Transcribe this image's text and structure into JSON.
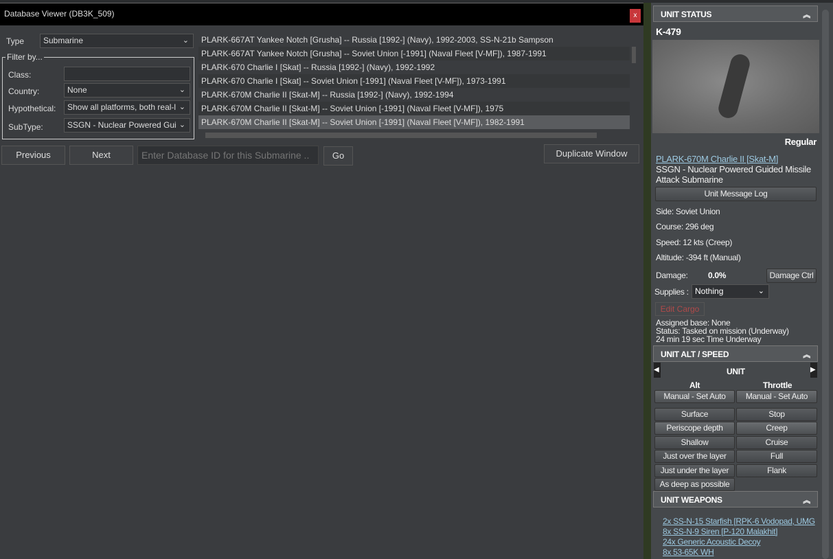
{
  "dialog": {
    "title": "Database Viewer (DB3K_509)",
    "close": "x",
    "type_label": "Type",
    "type_value": "Submarine",
    "filter_legend": "Filter by...",
    "class_label": "Class:",
    "class_value": "",
    "country_label": "Country:",
    "country_value": "None",
    "hypo_label": "Hypothetical:",
    "hypo_value": "Show all platforms, both real-l",
    "subtype_label": "SubType:",
    "subtype_value": "SSGN - Nuclear Powered Gui",
    "rows": [
      "PLARK-667AT Yankee Notch [Grusha] -- Russia [1992-] (Navy), 1992-2003, SS-N-21b Sampson",
      "PLARK-667AT Yankee Notch [Grusha] -- Soviet Union [-1991] (Naval Fleet [V-MF]), 1987-1991",
      "PLARK-670 Charlie I [Skat] -- Russia [1992-] (Navy), 1992-1992",
      "PLARK-670 Charlie I [Skat] -- Soviet Union [-1991] (Naval Fleet [V-MF]), 1973-1991",
      "PLARK-670M Charlie II [Skat-M] -- Russia [1992-] (Navy), 1992-1994",
      "PLARK-670M Charlie II [Skat-M] -- Soviet Union [-1991] (Naval Fleet [V-MF]), 1975",
      "PLARK-670M Charlie II [Skat-M] -- Soviet Union [-1991] (Naval Fleet [V-MF]), 1982-1991"
    ],
    "previous": "Previous",
    "next": "Next",
    "id_placeholder": "Enter Database ID for this Submarine ..",
    "go": "Go",
    "duplicate": "Duplicate Window"
  },
  "status": {
    "header": "UNIT STATUS",
    "name": "K-479",
    "proficiency": "Regular",
    "class_link": "PLARK-670M Charlie II [Skat-M]",
    "subtype": "SSGN - Nuclear Powered Guided Missile Attack Submarine",
    "message_log": "Unit Message Log",
    "side": "Side: Soviet Union",
    "course": "Course: 296 deg",
    "speed": "Speed: 12 kts (Creep)",
    "altitude": "Altitude: -394 ft (Manual)",
    "damage_label": "Damage:",
    "damage_value": "0.0%",
    "damage_ctrl": "Damage Ctrl",
    "supplies_label": "Supplies :",
    "supplies_value": "Nothing",
    "edit_cargo": "Edit Cargo",
    "base": "Assigned base: None",
    "state": "Status: Tasked on mission (Underway)",
    "time": "24 min 19 sec Time Underway"
  },
  "altspeed": {
    "header": "UNIT ALT / SPEED",
    "unit": "UNIT",
    "alt": "Alt",
    "throttle": "Throttle",
    "alt_auto": "Manual - Set Auto",
    "thr_auto": "Manual - Set Auto",
    "alt_buttons": [
      "Surface",
      "Periscope depth",
      "Shallow",
      "Just over the layer",
      "Just under the layer",
      "As deep as possible"
    ],
    "thr_buttons": [
      "Stop",
      "Creep",
      "Cruise",
      "Full",
      "Flank"
    ]
  },
  "weapons": {
    "header": "UNIT WEAPONS",
    "items": [
      "2x SS-N-15 Starfish [RPK-6 Vodopad, UMG",
      "8x SS-N-9 Siren [P-120 Malakhit]",
      "24x Generic Acoustic Decoy",
      "8x 53-65K WH"
    ]
  }
}
